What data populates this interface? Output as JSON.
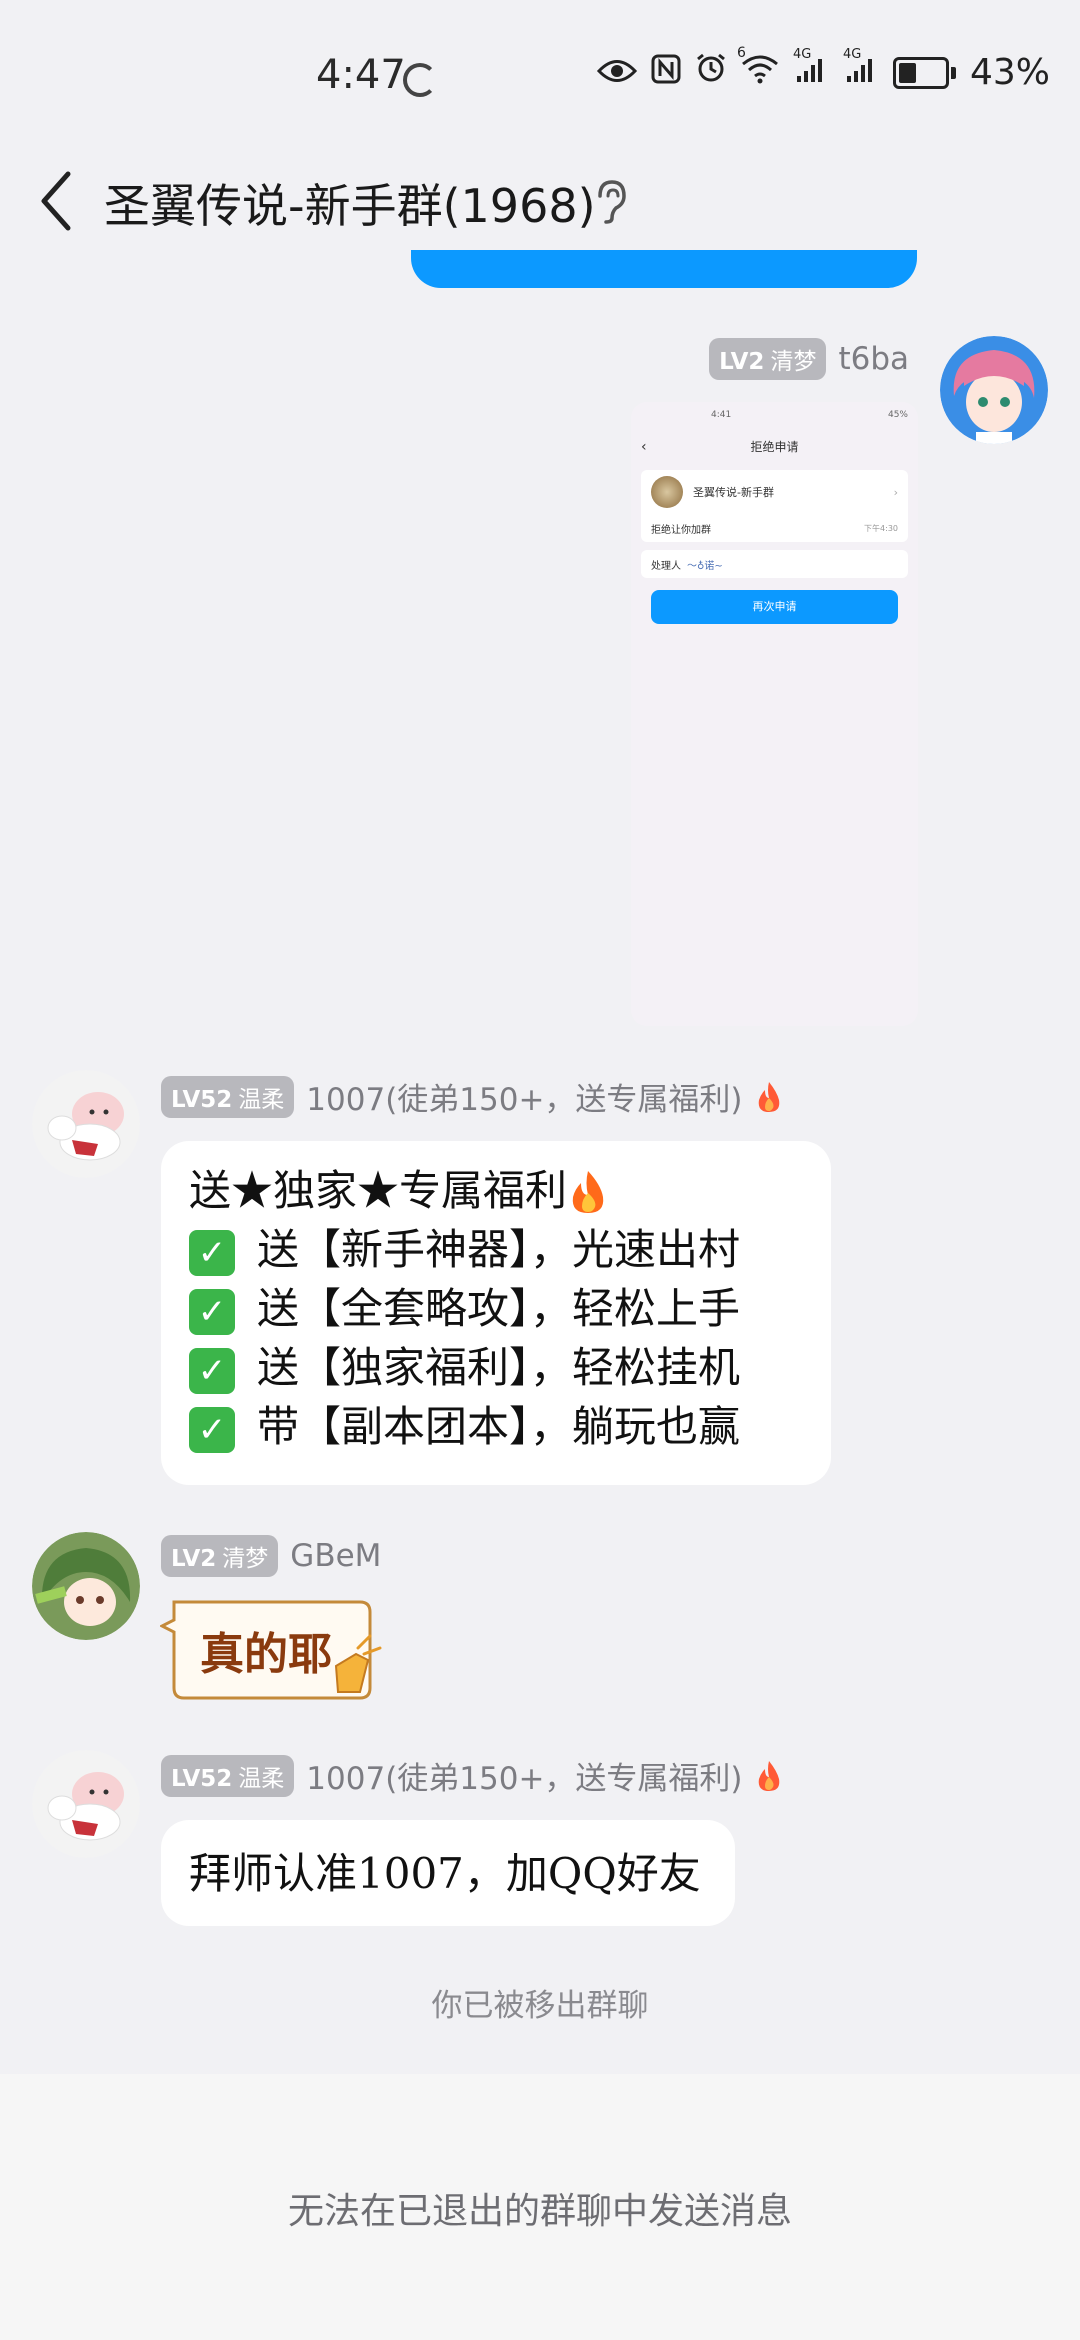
{
  "status_bar": {
    "time": "4:47",
    "network_4g_a": "4G",
    "network_4g_b": "4G",
    "wifi_badge": "6",
    "battery": "43%",
    "icons": [
      "eye-icon",
      "nfc-icon",
      "alarm-icon",
      "wifi-icon",
      "signal-icon",
      "signal-icon",
      "battery-icon"
    ]
  },
  "header": {
    "title": "圣翼传说-新手群(1968)"
  },
  "messages": [
    {
      "type": "image",
      "badge_level": "LV2",
      "badge_name": "清梦",
      "nickname": "t6ba",
      "screenshot": {
        "time": "4:41",
        "battery": "45%",
        "page_title": "拒绝申请",
        "group_name": "圣翼传说-新手群",
        "status_text": "拒绝让你加群",
        "status_time": "下午4:30",
        "handler_label": "处理人",
        "handler_value": "～♁诺~",
        "button": "再次申请"
      }
    },
    {
      "type": "text",
      "badge_level": "LV52",
      "badge_name": "温柔",
      "nickname": "1007(徒弟150+，送专属福利)",
      "lines": [
        "送★独家★专属福利",
        "送【新手神器】，光速出村",
        "送【全套略攻】，轻松上手",
        "送【独家福利】，轻松挂机",
        "带【副本团本】，躺玩也赢"
      ]
    },
    {
      "type": "sticker",
      "badge_level": "LV2",
      "badge_name": "清梦",
      "nickname": "GBeM",
      "sticker_text": "真的耶"
    },
    {
      "type": "text",
      "badge_level": "LV52",
      "badge_name": "温柔",
      "nickname": "1007(徒弟150+，送专属福利)",
      "text": "拜师认准1007，加QQ好友"
    }
  ],
  "system_note": "你已被移出群聊",
  "footer_text": "无法在已退出的群聊中发送消息",
  "colors": {
    "accent_blue": "#0c99ff",
    "background": "#f1f1f4",
    "badge_gray": "#b8b8bd",
    "check_green": "#3bb54a"
  }
}
